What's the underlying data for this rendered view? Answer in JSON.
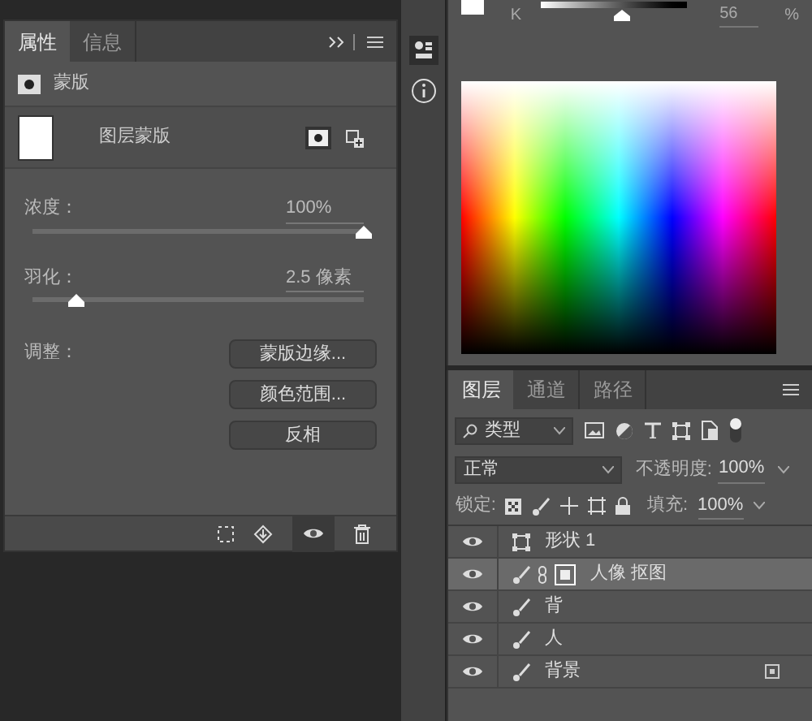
{
  "properties_panel": {
    "tabs": [
      {
        "label": "属性",
        "selected": true
      },
      {
        "label": "信息",
        "selected": false
      }
    ],
    "section_title": "蒙版",
    "mask_name": "图层蒙版",
    "sliders": [
      {
        "label": "浓度：",
        "reading": "100%",
        "level": 1.0
      },
      {
        "label": "羽化：",
        "reading": "2.5 像素",
        "level": 0.13
      }
    ],
    "adjust_label": "调整：",
    "buttons": [
      "蒙版边缘...",
      "颜色范围...",
      "反相"
    ]
  },
  "color_panel": {
    "channel": "K",
    "level": 0.56,
    "reading": "56",
    "unit": "%"
  },
  "layers_panel": {
    "tabs": [
      {
        "label": "图层",
        "selected": true
      },
      {
        "label": "通道",
        "selected": false
      },
      {
        "label": "路径",
        "selected": false
      }
    ],
    "filter": "类型",
    "blend_mode": "正常",
    "opacity_label": "不透明度:",
    "opacity": "100%",
    "lock_label": "锁定:",
    "fill_label": "填充:",
    "fill": "100%",
    "layers": [
      {
        "name": "形状 1",
        "kind": "shape",
        "selected": false,
        "visible": true,
        "locked": false
      },
      {
        "name": "人像 抠图",
        "kind": "masked",
        "selected": true,
        "visible": true,
        "locked": false
      },
      {
        "name": "背",
        "kind": "pixel",
        "selected": false,
        "visible": true,
        "locked": false
      },
      {
        "name": "人",
        "kind": "pixel",
        "selected": false,
        "visible": true,
        "locked": false
      },
      {
        "name": "背景",
        "kind": "pixel",
        "selected": false,
        "visible": true,
        "locked": true
      }
    ]
  }
}
